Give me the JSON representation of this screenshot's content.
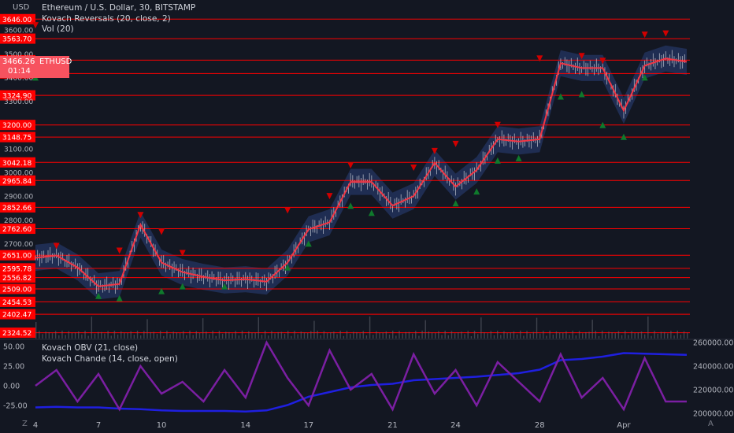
{
  "header": {
    "currency": "USD",
    "title": "Ethereum / U.S. Dollar, 30, BITSTAMP",
    "indicator1": "Kovach Reversals (20, close, 2)",
    "indicator2": "Vol (20)"
  },
  "ticker": {
    "price": "3466.26",
    "symbol": "ETHUSD",
    "countdown": "01:14"
  },
  "lower_pane": {
    "indicator1": "Kovach OBV (21, close)",
    "indicator2": "Kovach Chande (14, close, open)"
  },
  "footer": {
    "left_label": "Z",
    "right_label": "A"
  },
  "colors": {
    "background": "#131722",
    "level_line": "#ff0000",
    "level_label_bg": "#ff0000",
    "price_line": "#f23645",
    "band": "#2a3f7a",
    "bull_arrow": "#0f7a2c",
    "bear_arrow": "#d10000",
    "obv_line": "#1f1fe0",
    "chande_line": "#7b1fa2",
    "ticker_bg": "#f7525f"
  },
  "chart_data": [
    {
      "type": "line",
      "name": "price",
      "x": [
        "4",
        "5",
        "6",
        "7",
        "8",
        "9",
        "10",
        "11",
        "12",
        "13",
        "14",
        "15",
        "16",
        "17",
        "18",
        "19",
        "20",
        "21",
        "22",
        "23",
        "24",
        "25",
        "26",
        "27",
        "28",
        "29",
        "30",
        "31",
        "Apr",
        "2",
        "3",
        "4"
      ],
      "values": [
        2640,
        2650,
        2600,
        2520,
        2530,
        2780,
        2620,
        2580,
        2560,
        2545,
        2550,
        2540,
        2620,
        2760,
        2790,
        2960,
        2960,
        2860,
        2900,
        3040,
        2940,
        3010,
        3140,
        3130,
        3140,
        3460,
        3440,
        3440,
        3260,
        3450,
        3480,
        3466
      ],
      "x_tick_labels": [
        "7",
        "10",
        "14",
        "17",
        "21",
        "24",
        "28",
        "Apr",
        "4"
      ],
      "y_tick_labels": [
        "3600.00",
        "3500.00",
        "3400.00",
        "3300.00",
        "3100.00",
        "3000.00",
        "2900.00",
        "2800.00",
        "2700.00"
      ],
      "y_range": [
        2300,
        3700
      ],
      "horizontal_levels": [
        "3646.00",
        "3563.70",
        "3473.00",
        "3416.79",
        "3324.90",
        "3200.00",
        "3148.75",
        "3042.18",
        "2965.84",
        "2852.66",
        "2762.60",
        "2651.00",
        "2595.78",
        "2556.82",
        "2509.00",
        "2454.53",
        "2402.47",
        "2324.52"
      ],
      "bullish_reversal_points": [
        {
          "x": "7",
          "y": 2480
        },
        {
          "x": "8",
          "y": 2470
        },
        {
          "x": "10",
          "y": 2500
        },
        {
          "x": "11",
          "y": 2520
        },
        {
          "x": "13",
          "y": 2520
        },
        {
          "x": "16",
          "y": 2600
        },
        {
          "x": "17",
          "y": 2700
        },
        {
          "x": "19",
          "y": 2860
        },
        {
          "x": "20",
          "y": 2830
        },
        {
          "x": "24",
          "y": 2870
        },
        {
          "x": "25",
          "y": 2920
        },
        {
          "x": "26",
          "y": 3050
        },
        {
          "x": "27",
          "y": 3060
        },
        {
          "x": "29",
          "y": 3320
        },
        {
          "x": "30",
          "y": 3330
        },
        {
          "x": "31",
          "y": 3200
        },
        {
          "x": "Apr",
          "y": 3150
        },
        {
          "x": "2",
          "y": 3400
        },
        {
          "x": "4",
          "y": 3400
        }
      ],
      "bearish_reversal_points": [
        {
          "x": "5",
          "y": 2690
        },
        {
          "x": "8",
          "y": 2670
        },
        {
          "x": "9",
          "y": 2820
        },
        {
          "x": "10",
          "y": 2750
        },
        {
          "x": "11",
          "y": 2660
        },
        {
          "x": "16",
          "y": 2840
        },
        {
          "x": "18",
          "y": 2900
        },
        {
          "x": "19",
          "y": 3030
        },
        {
          "x": "22",
          "y": 3020
        },
        {
          "x": "23",
          "y": 3090
        },
        {
          "x": "24",
          "y": 3120
        },
        {
          "x": "26",
          "y": 3200
        },
        {
          "x": "28",
          "y": 3480
        },
        {
          "x": "30",
          "y": 3490
        },
        {
          "x": "31",
          "y": 3470
        },
        {
          "x": "2",
          "y": 3580
        },
        {
          "x": "3",
          "y": 3585
        },
        {
          "x": "4",
          "y": 3620
        }
      ]
    },
    {
      "type": "line",
      "name": "Kovach OBV (21, close)",
      "x": [
        "4",
        "5",
        "6",
        "7",
        "8",
        "9",
        "10",
        "11",
        "12",
        "13",
        "14",
        "15",
        "16",
        "17",
        "18",
        "19",
        "20",
        "21",
        "22",
        "23",
        "24",
        "25",
        "26",
        "27",
        "28",
        "29",
        "30",
        "31",
        "Apr",
        "2",
        "3",
        "4"
      ],
      "values": [
        205000,
        205500,
        205000,
        205000,
        204000,
        203500,
        202500,
        202000,
        202000,
        202000,
        201500,
        202500,
        207000,
        214000,
        218000,
        222000,
        224000,
        225000,
        228000,
        229000,
        230000,
        231000,
        232500,
        234000,
        237000,
        245000,
        246000,
        248000,
        251000,
        250500,
        250000,
        249500
      ],
      "y_tick_labels": [
        "260000.00",
        "240000.00",
        "220000.00",
        "200000.00"
      ],
      "y_range": [
        198000,
        262000
      ]
    },
    {
      "type": "line",
      "name": "Kovach Chande (14, close, open)",
      "x": [
        "4",
        "5",
        "6",
        "7",
        "8",
        "9",
        "10",
        "11",
        "12",
        "13",
        "14",
        "15",
        "16",
        "17",
        "18",
        "19",
        "20",
        "21",
        "22",
        "23",
        "24",
        "25",
        "26",
        "27",
        "28",
        "29",
        "30",
        "31",
        "Apr",
        "2",
        "3",
        "4"
      ],
      "values": [
        0,
        20,
        -20,
        15,
        -30,
        25,
        -10,
        5,
        -20,
        20,
        -15,
        55,
        10,
        -25,
        45,
        -5,
        15,
        -30,
        40,
        -10,
        20,
        -25,
        30,
        5,
        -20,
        40,
        -15,
        10,
        -30,
        35,
        -20,
        -20
      ],
      "y_tick_labels": [
        "50.00",
        "25.00",
        "0.00",
        "-25.00"
      ],
      "y_range": [
        -38,
        58
      ]
    }
  ]
}
